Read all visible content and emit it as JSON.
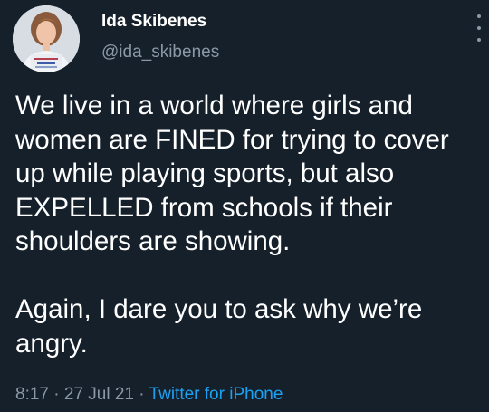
{
  "author": {
    "display_name": "Ida Skibenes",
    "handle": "@ida_skibenes",
    "avatar_icon": "profile-photo"
  },
  "tweet": {
    "paragraphs": [
      "We live in a world where girls and women are FINED for trying to cover up while playing sports, but also EXPELLED from schools if their shoulders are showing.",
      "Again, I dare you to ask why we’re angry."
    ],
    "time": "8:17",
    "separator": " · ",
    "date": "27 Jul 21",
    "source": "Twitter for iPhone"
  },
  "colors": {
    "background": "#15202b",
    "text": "#ffffff",
    "secondary": "#8b98a5",
    "link": "#1da1f2"
  },
  "menu": {
    "icon": "more-vertical-icon"
  }
}
